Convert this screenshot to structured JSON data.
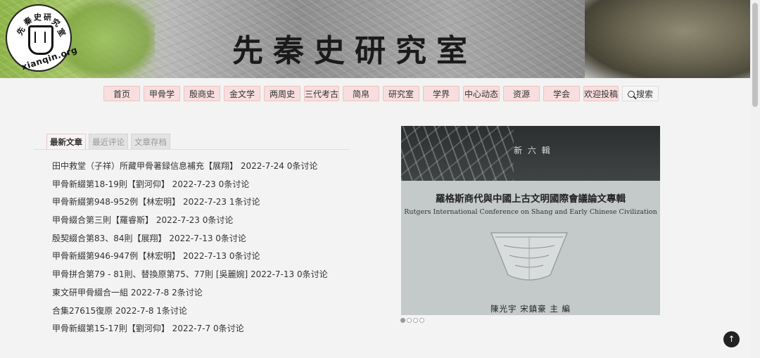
{
  "site": {
    "title": "先秦史研究室",
    "logo_text": "xianqin.org",
    "logo_glyphs": [
      "先",
      "秦",
      "史",
      "研",
      "究",
      "室"
    ]
  },
  "nav": [
    {
      "label": "首页",
      "w": 52
    },
    {
      "label": "甲骨学",
      "w": 52
    },
    {
      "label": "殷商史",
      "w": 52
    },
    {
      "label": "金文学",
      "w": 52
    },
    {
      "label": "两周史",
      "w": 52
    },
    {
      "label": "三代考古",
      "w": 50
    },
    {
      "label": "简帛",
      "w": 52
    },
    {
      "label": "研究室",
      "w": 52
    },
    {
      "label": "学界",
      "w": 52
    },
    {
      "label": "中心动态",
      "w": 52
    },
    {
      "label": "资源",
      "w": 52
    },
    {
      "label": "学会",
      "w": 52
    },
    {
      "label": "欢迎投稿",
      "w": 50
    },
    {
      "label": "搜索",
      "w": 52
    }
  ],
  "tabs": [
    {
      "label": "最新文章",
      "active": true
    },
    {
      "label": "最近评论",
      "active": false
    },
    {
      "label": "文章存档",
      "active": false
    }
  ],
  "articles": [
    "田中救堂（子祥）所藏甲骨著録信息補充【展翔】 2022-7-24  0条讨论",
    "甲骨新綴第18-19則【劉河仰】 2022-7-23  0条讨论",
    "甲骨新綴第948-952例【林宏明】 2022-7-23  1条讨论",
    "甲骨綴合第三則【羅睿斯】 2022-7-23  0条讨论",
    "殷契綴合第83、84則【展翔】 2022-7-13  0条讨论",
    "甲骨新綴第946-947例【林宏明】 2022-7-13  0条讨论",
    "甲骨拼合第79 - 81則、替換原第75、77則 [吳麗婉] 2022-7-13  0条讨论",
    "東文研甲骨綴合一組 2022-7-8  2条讨论",
    "合集27615復原 2022-7-8  1条讨论",
    "甲骨新綴第15-17則【劉河仰】 2022-7-7  0条讨论"
  ],
  "slider": {
    "edition": "新 六 輯",
    "title_cn": "羅格斯商代與中國上古文明國際會議論文專輯",
    "title_en": "Rutgers International Conference on Shang and Early Chinese Civilization",
    "editors": "陳光宇   宋鎮豪   主 編",
    "slide_count": 4,
    "active_slide": 1
  },
  "to_top_icon": "↑"
}
